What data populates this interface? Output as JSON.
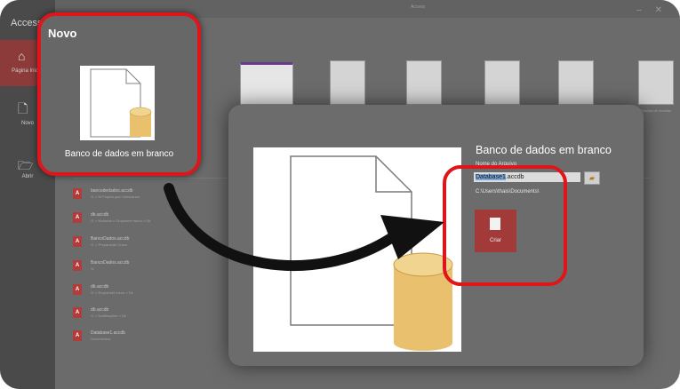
{
  "app": {
    "name": "Access",
    "window_title": "Access"
  },
  "nav": {
    "home": "Página Inicial",
    "new": "Novo",
    "open": "Abrir"
  },
  "templates": {
    "captions": [
      "",
      "",
      "",
      "",
      "",
      "",
      "Planilha de receitas",
      ""
    ]
  },
  "recent": [
    {
      "name": "bancodedados.accdb",
      "path": "G: » M Projeto que Otimizaram"
    },
    {
      "name": "db.accdb",
      "path": "G: » Modelos » Dropsheet menu » Db"
    },
    {
      "name": "BancoDados.accdb",
      "path": "G: » Preparação Curso"
    },
    {
      "name": "BancoDados.accdb",
      "path": "G:"
    },
    {
      "name": "db.accdb",
      "path": "G: » Dropsheet menu » Db"
    },
    {
      "name": "db.accdb",
      "path": "G: » Notificações » Db"
    },
    {
      "name": "Database1.accdb",
      "path": "Documentos"
    }
  ],
  "callout": {
    "title": "Novo",
    "label": "Banco de dados em branco"
  },
  "dialog": {
    "title": "Banco de dados em branco",
    "name_label": "Nome do Arquivo",
    "file_name_selected": "Database1",
    "file_name_ext": ".accdb",
    "path": "C:\\Users\\thais\\Documents\\",
    "create_label": "Criar"
  },
  "colors": {
    "highlight": "#e0151b",
    "access_red": "#a23a3a",
    "db_gold": "#e8c06e"
  }
}
